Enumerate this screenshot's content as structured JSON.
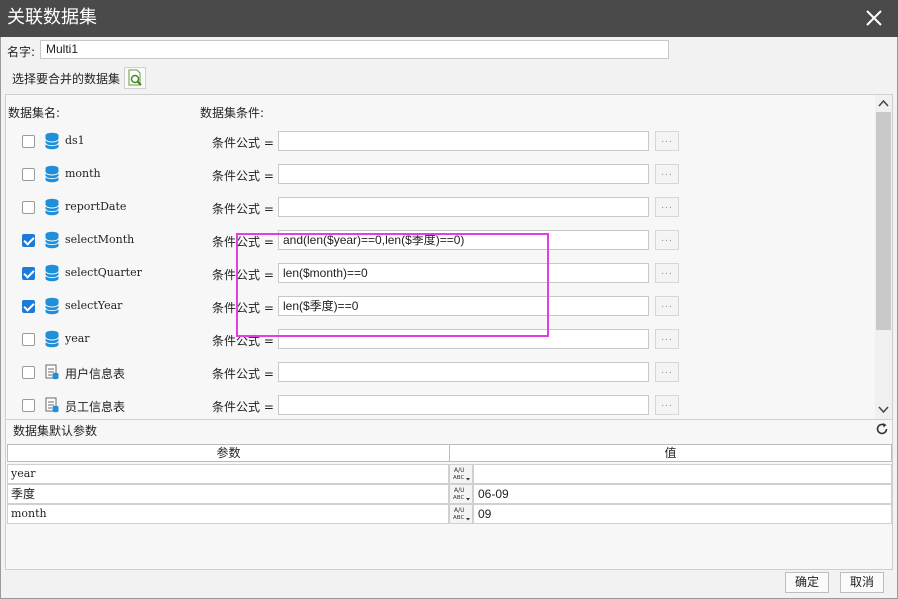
{
  "window": {
    "title": "关联数据集"
  },
  "name_field": {
    "label": "名字:",
    "value": "Multi1"
  },
  "select_section": {
    "label": "选择要合并的数据集",
    "button_icon": "preview-search-icon"
  },
  "headers": {
    "dataset_name": "数据集名:",
    "dataset_condition": "数据集条件:"
  },
  "datasets": [
    {
      "name": "ds1",
      "icon": "database-icon",
      "checked": false,
      "condition_label": "条件公式 =",
      "condition": "",
      "button_label": "..."
    },
    {
      "name": "month",
      "icon": "database-icon",
      "checked": false,
      "condition_label": "条件公式 =",
      "condition": "",
      "button_label": "..."
    },
    {
      "name": "reportDate",
      "icon": "database-icon",
      "checked": false,
      "condition_label": "条件公式 =",
      "condition": "",
      "button_label": "..."
    },
    {
      "name": "selectMonth",
      "icon": "database-icon",
      "checked": true,
      "condition_label": "条件公式 =",
      "condition": "and(len($year)==0,len($季度)==0)",
      "button_label": "..."
    },
    {
      "name": "selectQuarter",
      "icon": "database-icon",
      "checked": true,
      "condition_label": "条件公式 =",
      "condition": "len($month)==0",
      "button_label": "..."
    },
    {
      "name": "selectYear",
      "icon": "database-icon",
      "checked": true,
      "condition_label": "条件公式 =",
      "condition": "len($季度)==0",
      "button_label": "..."
    },
    {
      "name": "year",
      "icon": "database-icon",
      "checked": false,
      "condition_label": "条件公式 =",
      "condition": "",
      "button_label": "..."
    },
    {
      "name": "用户信息表",
      "icon": "table-file-icon",
      "checked": false,
      "condition_label": "条件公式 =",
      "condition": "",
      "button_label": "..."
    },
    {
      "name": "员工信息表",
      "icon": "table-file-icon",
      "checked": false,
      "condition_label": "条件公式 =",
      "condition": "",
      "button_label": "..."
    }
  ],
  "default_params": {
    "title": "数据集默认参数",
    "columns": [
      "参数",
      "值"
    ],
    "rows": [
      {
        "name": "year",
        "value": ""
      },
      {
        "name": "季度",
        "value": "06-09"
      },
      {
        "name": "month",
        "value": "09"
      }
    ]
  },
  "buttons": {
    "ok": "确定",
    "cancel": "取消"
  },
  "colors": {
    "titlebar": "#4a4a4a",
    "checkbox_checked": "#1c7ad9",
    "database_icon": "#1f8fd9",
    "highlight": "#e33ee3"
  }
}
